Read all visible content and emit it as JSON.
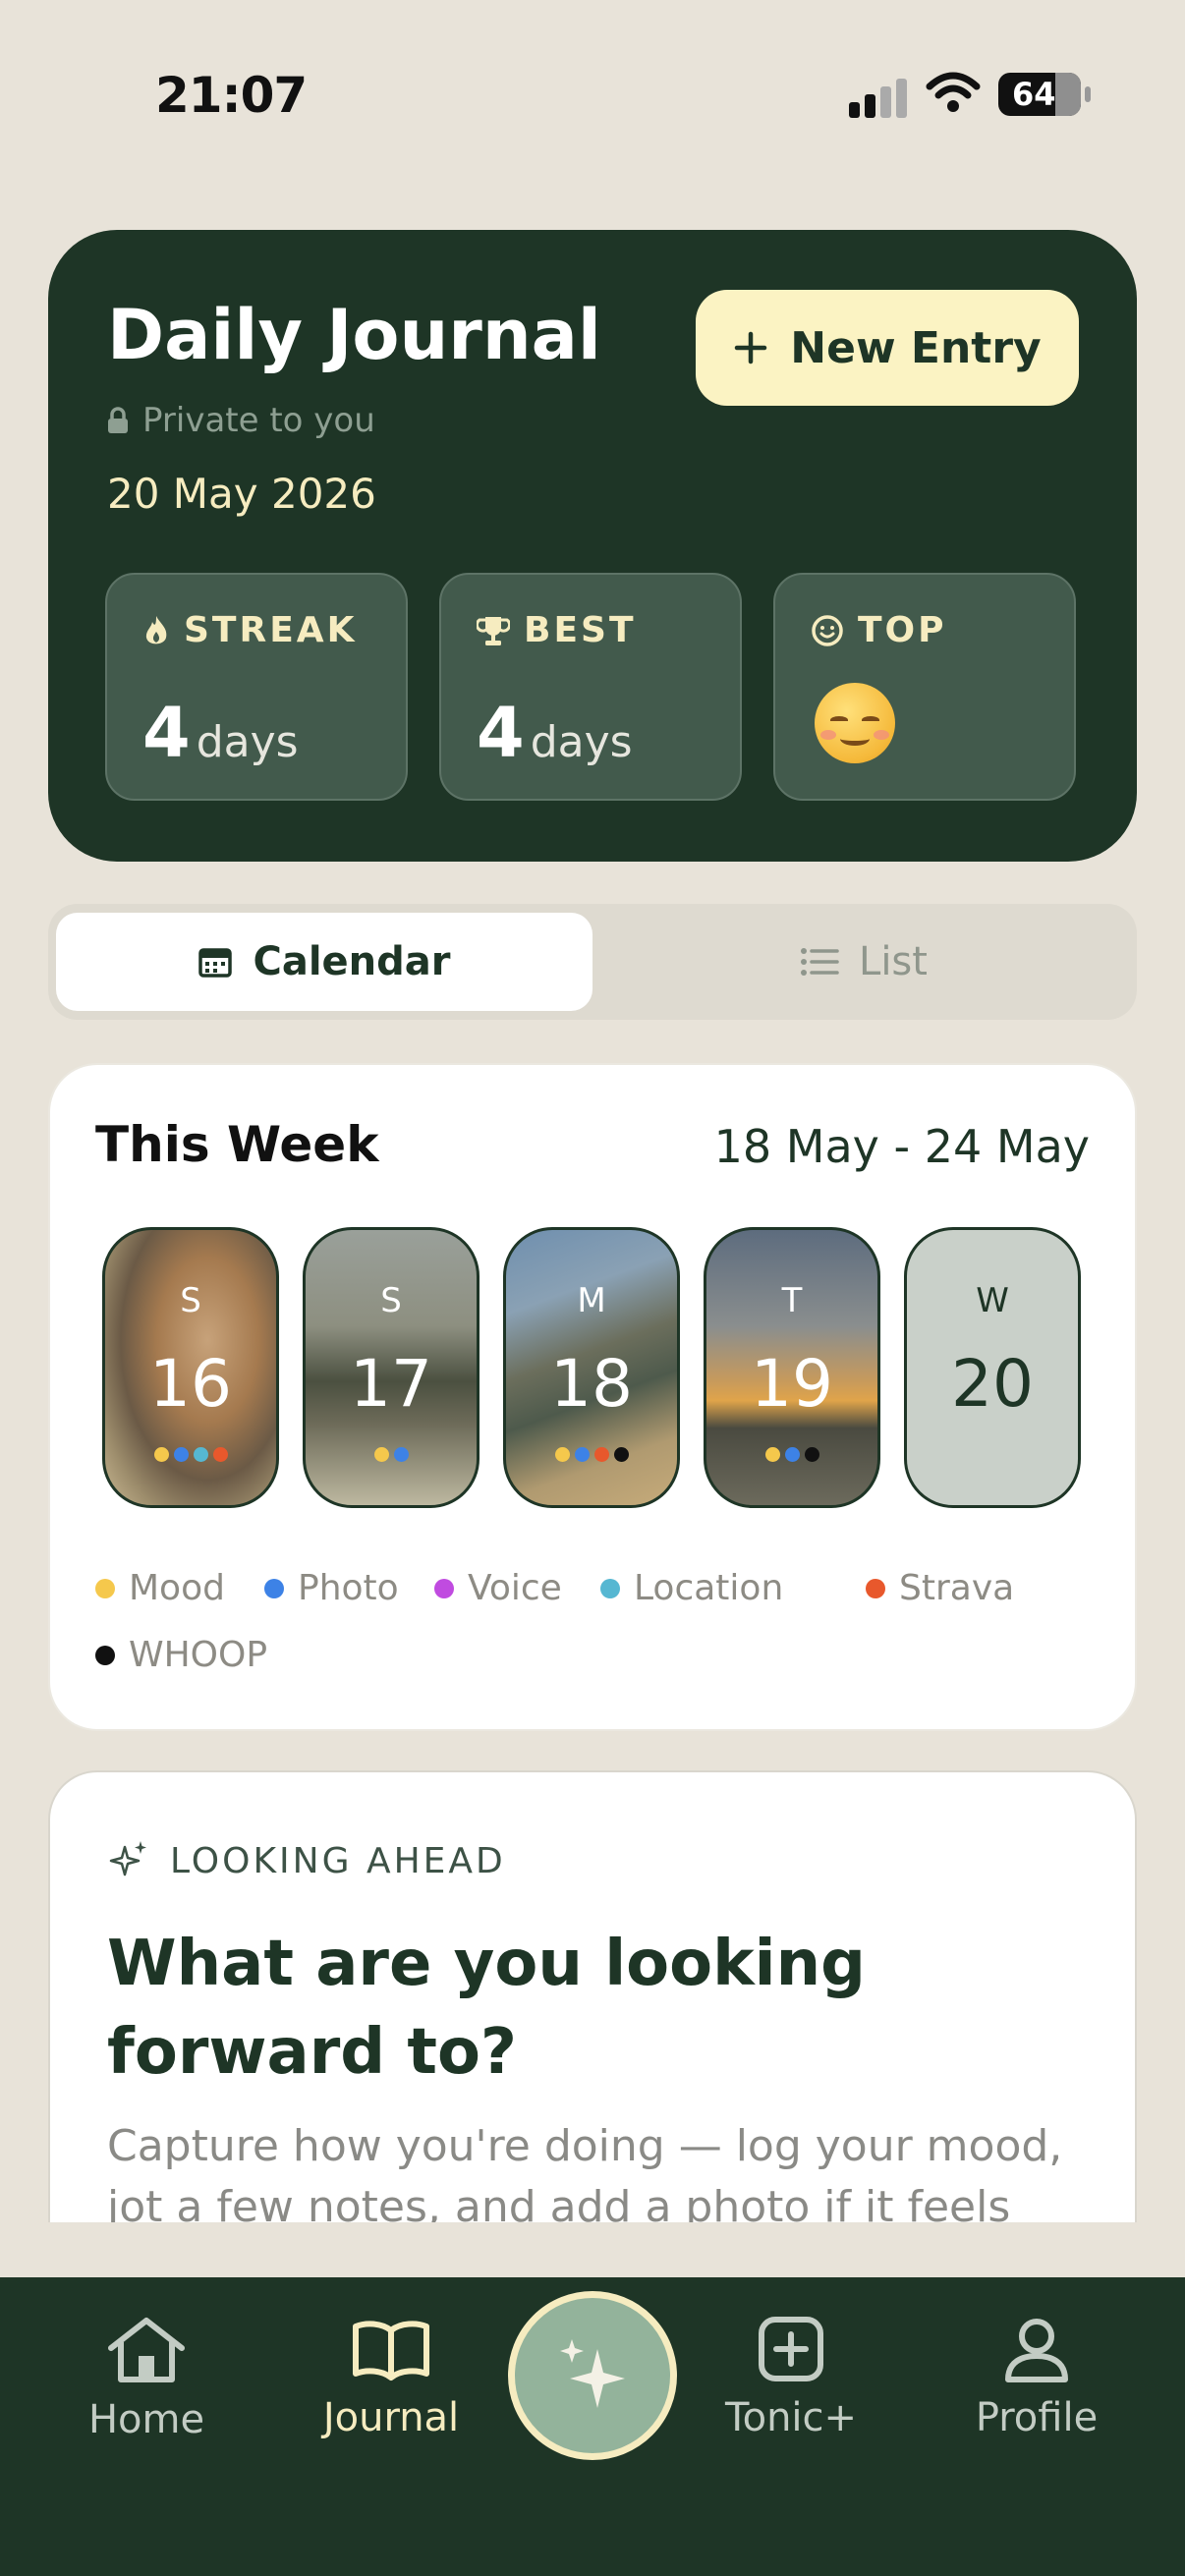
{
  "status_bar": {
    "time": "21:07",
    "battery": "64"
  },
  "header": {
    "title": "Daily Journal",
    "privacy": "Private to you",
    "date": "20 May 2026",
    "new_entry_label": "New Entry",
    "stats": [
      {
        "label": "STREAK",
        "value": "4",
        "unit": "days",
        "icon": "flame-icon"
      },
      {
        "label": "BEST",
        "value": "4",
        "unit": "days",
        "icon": "trophy-icon"
      },
      {
        "label": "TOP",
        "value": "",
        "unit": "",
        "icon": "smile-icon",
        "emoji": "smiling-face-emoji"
      }
    ]
  },
  "view_toggle": {
    "calendar": "Calendar",
    "list": "List",
    "selected": "Calendar"
  },
  "week": {
    "title": "This Week",
    "range": "18 May - 24 May",
    "days": [
      {
        "letter": "S",
        "date": "16",
        "dots": [
          "#f5c84c",
          "#3d82e6",
          "#56b7d2",
          "#e8582c"
        ]
      },
      {
        "letter": "S",
        "date": "17",
        "dots": [
          "#f5c84c",
          "#3d82e6"
        ]
      },
      {
        "letter": "M",
        "date": "18",
        "dots": [
          "#f5c84c",
          "#3d82e6",
          "#e8582c",
          "#111111"
        ]
      },
      {
        "letter": "T",
        "date": "19",
        "dots": [
          "#f5c84c",
          "#3d82e6",
          "#111111"
        ]
      },
      {
        "letter": "W",
        "date": "20",
        "dots": []
      }
    ],
    "legend": [
      {
        "label": "Mood",
        "color": "#f5c84c"
      },
      {
        "label": "Photo",
        "color": "#3d82e6"
      },
      {
        "label": "Voice",
        "color": "#c04be0"
      },
      {
        "label": "Location",
        "color": "#56b7d2"
      },
      {
        "label": "Strava",
        "color": "#e8582c"
      },
      {
        "label": "WHOOP",
        "color": "#111111"
      }
    ]
  },
  "looking_ahead": {
    "tag": "LOOKING AHEAD",
    "heading": "What are you looking forward to?",
    "body": "Capture how you're doing — log your mood, jot a few notes, and add a photo if it feels right."
  },
  "nav": {
    "home": "Home",
    "journal": "Journal",
    "tonic": "Tonic+",
    "profile": "Profile",
    "active": "Journal"
  },
  "colors": {
    "primary": "#1e3526",
    "accent": "#fbf3c3",
    "background": "#e8e3d9"
  }
}
